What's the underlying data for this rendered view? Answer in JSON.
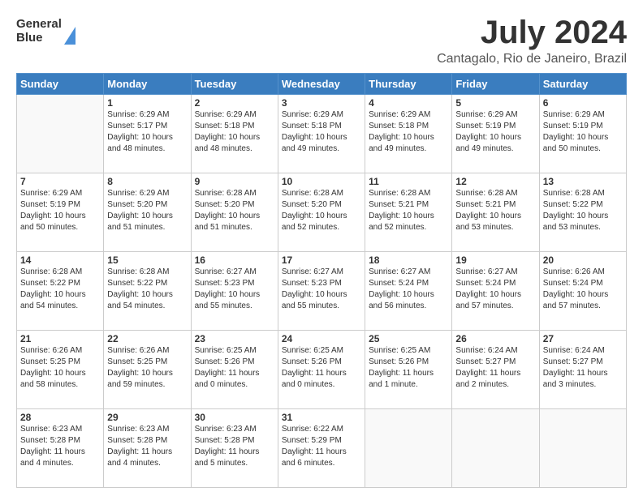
{
  "header": {
    "logo_line1": "General",
    "logo_line2": "Blue",
    "title": "July 2024",
    "subtitle": "Cantagalo, Rio de Janeiro, Brazil"
  },
  "days_of_week": [
    "Sunday",
    "Monday",
    "Tuesday",
    "Wednesday",
    "Thursday",
    "Friday",
    "Saturday"
  ],
  "weeks": [
    [
      {
        "day": "",
        "info": ""
      },
      {
        "day": "1",
        "info": "Sunrise: 6:29 AM\nSunset: 5:17 PM\nDaylight: 10 hours\nand 48 minutes."
      },
      {
        "day": "2",
        "info": "Sunrise: 6:29 AM\nSunset: 5:18 PM\nDaylight: 10 hours\nand 48 minutes."
      },
      {
        "day": "3",
        "info": "Sunrise: 6:29 AM\nSunset: 5:18 PM\nDaylight: 10 hours\nand 49 minutes."
      },
      {
        "day": "4",
        "info": "Sunrise: 6:29 AM\nSunset: 5:18 PM\nDaylight: 10 hours\nand 49 minutes."
      },
      {
        "day": "5",
        "info": "Sunrise: 6:29 AM\nSunset: 5:19 PM\nDaylight: 10 hours\nand 49 minutes."
      },
      {
        "day": "6",
        "info": "Sunrise: 6:29 AM\nSunset: 5:19 PM\nDaylight: 10 hours\nand 50 minutes."
      }
    ],
    [
      {
        "day": "7",
        "info": "Sunrise: 6:29 AM\nSunset: 5:19 PM\nDaylight: 10 hours\nand 50 minutes."
      },
      {
        "day": "8",
        "info": "Sunrise: 6:29 AM\nSunset: 5:20 PM\nDaylight: 10 hours\nand 51 minutes."
      },
      {
        "day": "9",
        "info": "Sunrise: 6:28 AM\nSunset: 5:20 PM\nDaylight: 10 hours\nand 51 minutes."
      },
      {
        "day": "10",
        "info": "Sunrise: 6:28 AM\nSunset: 5:20 PM\nDaylight: 10 hours\nand 52 minutes."
      },
      {
        "day": "11",
        "info": "Sunrise: 6:28 AM\nSunset: 5:21 PM\nDaylight: 10 hours\nand 52 minutes."
      },
      {
        "day": "12",
        "info": "Sunrise: 6:28 AM\nSunset: 5:21 PM\nDaylight: 10 hours\nand 53 minutes."
      },
      {
        "day": "13",
        "info": "Sunrise: 6:28 AM\nSunset: 5:22 PM\nDaylight: 10 hours\nand 53 minutes."
      }
    ],
    [
      {
        "day": "14",
        "info": "Sunrise: 6:28 AM\nSunset: 5:22 PM\nDaylight: 10 hours\nand 54 minutes."
      },
      {
        "day": "15",
        "info": "Sunrise: 6:28 AM\nSunset: 5:22 PM\nDaylight: 10 hours\nand 54 minutes."
      },
      {
        "day": "16",
        "info": "Sunrise: 6:27 AM\nSunset: 5:23 PM\nDaylight: 10 hours\nand 55 minutes."
      },
      {
        "day": "17",
        "info": "Sunrise: 6:27 AM\nSunset: 5:23 PM\nDaylight: 10 hours\nand 55 minutes."
      },
      {
        "day": "18",
        "info": "Sunrise: 6:27 AM\nSunset: 5:24 PM\nDaylight: 10 hours\nand 56 minutes."
      },
      {
        "day": "19",
        "info": "Sunrise: 6:27 AM\nSunset: 5:24 PM\nDaylight: 10 hours\nand 57 minutes."
      },
      {
        "day": "20",
        "info": "Sunrise: 6:26 AM\nSunset: 5:24 PM\nDaylight: 10 hours\nand 57 minutes."
      }
    ],
    [
      {
        "day": "21",
        "info": "Sunrise: 6:26 AM\nSunset: 5:25 PM\nDaylight: 10 hours\nand 58 minutes."
      },
      {
        "day": "22",
        "info": "Sunrise: 6:26 AM\nSunset: 5:25 PM\nDaylight: 10 hours\nand 59 minutes."
      },
      {
        "day": "23",
        "info": "Sunrise: 6:25 AM\nSunset: 5:26 PM\nDaylight: 11 hours\nand 0 minutes."
      },
      {
        "day": "24",
        "info": "Sunrise: 6:25 AM\nSunset: 5:26 PM\nDaylight: 11 hours\nand 0 minutes."
      },
      {
        "day": "25",
        "info": "Sunrise: 6:25 AM\nSunset: 5:26 PM\nDaylight: 11 hours\nand 1 minute."
      },
      {
        "day": "26",
        "info": "Sunrise: 6:24 AM\nSunset: 5:27 PM\nDaylight: 11 hours\nand 2 minutes."
      },
      {
        "day": "27",
        "info": "Sunrise: 6:24 AM\nSunset: 5:27 PM\nDaylight: 11 hours\nand 3 minutes."
      }
    ],
    [
      {
        "day": "28",
        "info": "Sunrise: 6:23 AM\nSunset: 5:28 PM\nDaylight: 11 hours\nand 4 minutes."
      },
      {
        "day": "29",
        "info": "Sunrise: 6:23 AM\nSunset: 5:28 PM\nDaylight: 11 hours\nand 4 minutes."
      },
      {
        "day": "30",
        "info": "Sunrise: 6:23 AM\nSunset: 5:28 PM\nDaylight: 11 hours\nand 5 minutes."
      },
      {
        "day": "31",
        "info": "Sunrise: 6:22 AM\nSunset: 5:29 PM\nDaylight: 11 hours\nand 6 minutes."
      },
      {
        "day": "",
        "info": ""
      },
      {
        "day": "",
        "info": ""
      },
      {
        "day": "",
        "info": ""
      }
    ]
  ]
}
